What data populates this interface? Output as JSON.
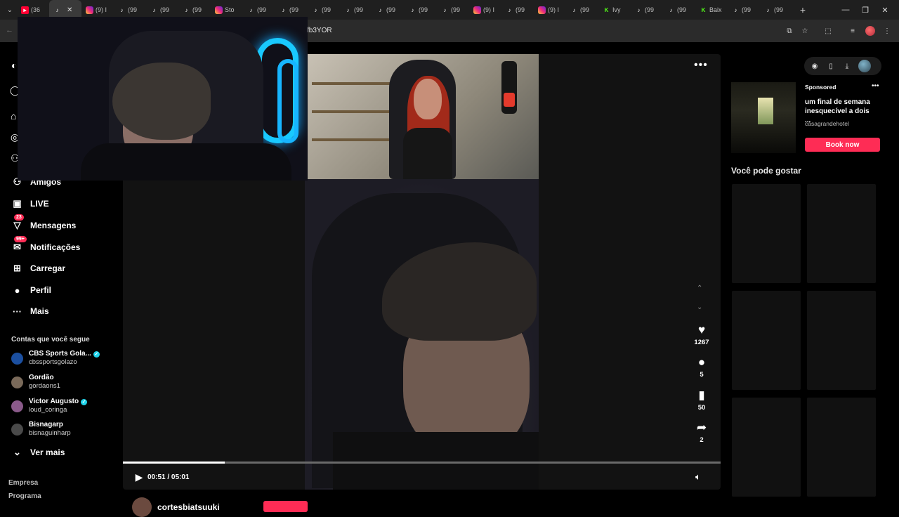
{
  "tabs": [
    {
      "kind": "yt",
      "label": "(36"
    },
    {
      "kind": "tt",
      "label": "",
      "active": true
    },
    {
      "kind": "ig",
      "label": "(9) I"
    },
    {
      "kind": "tt",
      "label": "(99"
    },
    {
      "kind": "tt",
      "label": "(99"
    },
    {
      "kind": "tt",
      "label": "(99"
    },
    {
      "kind": "ig",
      "label": "Sto"
    },
    {
      "kind": "tt",
      "label": "(99"
    },
    {
      "kind": "tt",
      "label": "(99"
    },
    {
      "kind": "tt",
      "label": "(99"
    },
    {
      "kind": "tt",
      "label": "(99"
    },
    {
      "kind": "tt",
      "label": "(99"
    },
    {
      "kind": "tt",
      "label": "(99"
    },
    {
      "kind": "tt",
      "label": "(99"
    },
    {
      "kind": "ig",
      "label": "(9) I"
    },
    {
      "kind": "tt",
      "label": "(99"
    },
    {
      "kind": "ig",
      "label": "(9) I"
    },
    {
      "kind": "tt",
      "label": "(99"
    },
    {
      "kind": "kick",
      "label": "Ivy"
    },
    {
      "kind": "tt",
      "label": "(99"
    },
    {
      "kind": "tt",
      "label": "(99"
    },
    {
      "kind": "kick",
      "label": "Baix"
    },
    {
      "kind": "tt",
      "label": "(99"
    },
    {
      "kind": "tt",
      "label": "(99"
    }
  ],
  "address": {
    "url_fragment": "fb3YOR"
  },
  "nav": {
    "items": [
      {
        "label": "Amigos",
        "icon": "friends-icon",
        "badge": ""
      },
      {
        "label": "LIVE",
        "icon": "live-icon",
        "badge": ""
      },
      {
        "label": "Mensagens",
        "icon": "messages-icon",
        "badge": "23"
      },
      {
        "label": "Notificações",
        "icon": "notifications-icon",
        "badge": "99+"
      },
      {
        "label": "Carregar",
        "icon": "upload-icon",
        "badge": ""
      },
      {
        "label": "Perfil",
        "icon": "profile-icon",
        "badge": ""
      },
      {
        "label": "Mais",
        "icon": "more-icon",
        "badge": ""
      }
    ],
    "following_heading": "Contas que você segue",
    "accounts": [
      {
        "name": "CBS Sports Gola...",
        "handle": "cbssportsgolazo",
        "verified": true
      },
      {
        "name": "Gordão",
        "handle": "gordaons1",
        "verified": false
      },
      {
        "name": "Victor Augusto",
        "handle": "loud_coringa",
        "verified": true
      },
      {
        "name": "Bisnagarp",
        "handle": "bisnaguinharp",
        "verified": false
      }
    ],
    "see_more": "Ver mais",
    "footer": [
      "Empresa",
      "Programa"
    ]
  },
  "player": {
    "time": "00:51 / 05:01",
    "progress": 0.17,
    "likes": "1267",
    "comments": "5",
    "saves": "50",
    "shares": "2",
    "author": "cortesbiatsuuki"
  },
  "ad": {
    "label": "Sponsored",
    "title": "um final de semana inesquecível a dois ...",
    "domain": "casagrandehotel",
    "cta": "Book now"
  },
  "suggestions": {
    "title": "Você pode gostar"
  },
  "colors": {
    "accent": "#fe2c55",
    "verified": "#20d5ec"
  }
}
